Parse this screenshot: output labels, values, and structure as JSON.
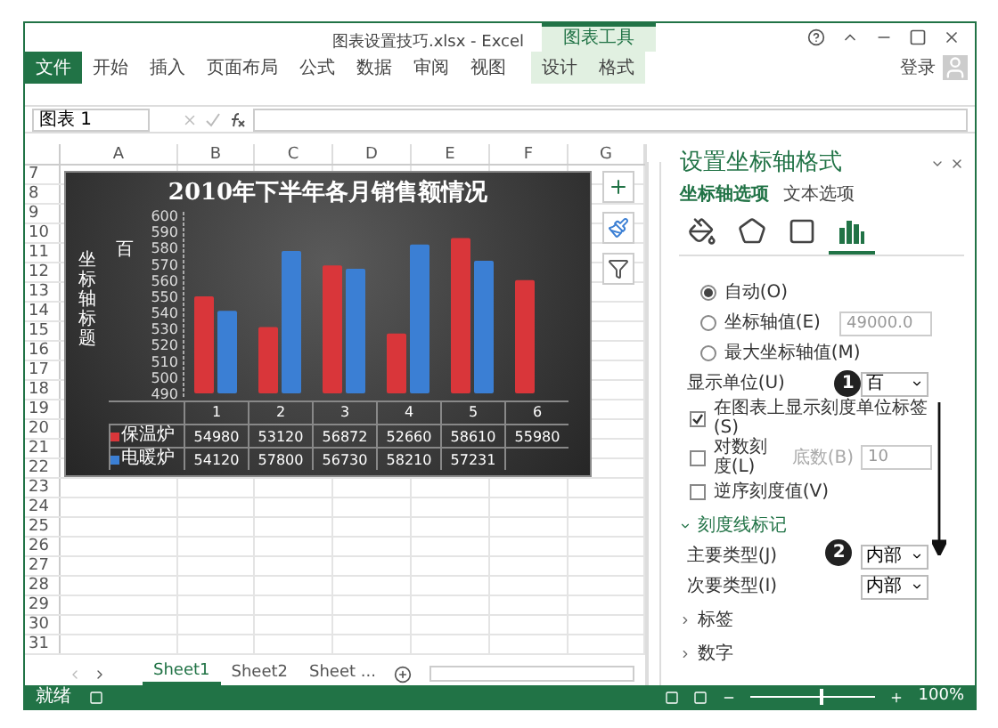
{
  "window": {
    "title": "图表设置技巧.xlsx - Excel"
  },
  "ribbon": {
    "context_group": "图表工具",
    "account": "登录",
    "tabs": [
      {
        "label": "文件",
        "kind": "file"
      },
      {
        "label": "开始",
        "kind": "normal"
      },
      {
        "label": "插入",
        "kind": "normal"
      },
      {
        "label": "页面布局",
        "kind": "normal"
      },
      {
        "label": "公式",
        "kind": "normal"
      },
      {
        "label": "数据",
        "kind": "normal"
      },
      {
        "label": "审阅",
        "kind": "normal"
      },
      {
        "label": "视图",
        "kind": "normal"
      },
      {
        "label": "设计",
        "kind": "contextual"
      },
      {
        "label": "格式",
        "kind": "contextual"
      }
    ]
  },
  "formula_bar": {
    "name_box": "图表 1"
  },
  "sheet": {
    "columns": [
      "A",
      "B",
      "C",
      "D",
      "E",
      "F",
      "G"
    ],
    "rows": [
      "7",
      "8",
      "9",
      "10",
      "11",
      "12",
      "13",
      "14",
      "15",
      "16",
      "17",
      "18",
      "19",
      "20",
      "21",
      "22",
      "23",
      "24",
      "25",
      "26",
      "27",
      "28",
      "29",
      "30",
      "31"
    ]
  },
  "chart": {
    "display_unit_label": "百",
    "chart_data": {
      "type": "bar",
      "title": "2010年下半年各月销售额情况",
      "ylabel": "坐标轴标题",
      "categories": [
        "1",
        "2",
        "3",
        "4",
        "5",
        "6"
      ],
      "series": [
        {
          "name": "保温炉",
          "color": "#d9363a",
          "values": [
            550,
            531,
            569,
            527,
            586,
            560
          ]
        },
        {
          "name": "电暖炉",
          "color": "#3b7fd4",
          "values": [
            541,
            578,
            567,
            582,
            572,
            null
          ]
        }
      ],
      "legend": "bottom-left",
      "ylim": [
        490,
        600
      ],
      "yticks": [
        490,
        500,
        510,
        520,
        530,
        540,
        550,
        560,
        570,
        580,
        590,
        600
      ]
    },
    "data_table": [
      {
        "cells": [
          "54980",
          "53120",
          "56872",
          "52660",
          "58610",
          "55980"
        ]
      },
      {
        "cells": [
          "54120",
          "57800",
          "56730",
          "58210",
          "57231",
          ""
        ]
      }
    ]
  },
  "format_pane": {
    "title": "设置坐标轴格式",
    "tabs": [
      {
        "label": "坐标轴选项",
        "selected": true
      },
      {
        "label": "文本选项",
        "selected": false
      }
    ],
    "icon_tabs": [
      {
        "kind": "fill",
        "selected": false
      },
      {
        "kind": "effects",
        "selected": false
      },
      {
        "kind": "size",
        "selected": false
      },
      {
        "kind": "axis",
        "selected": true
      }
    ],
    "options": [
      {
        "kind": "radio",
        "label": "自动(O)",
        "selected": true
      },
      {
        "kind": "radio",
        "label": "坐标轴值(E)",
        "selected": false,
        "value": "49000.0",
        "disabled": true
      },
      {
        "kind": "radio",
        "label": "最大坐标轴值(M)",
        "selected": false
      },
      {
        "kind": "select",
        "label": "显示单位(U)",
        "value": "百"
      },
      {
        "kind": "checkbox",
        "label": "在图表上显示刻度单位标签(S)",
        "checked": true
      },
      {
        "kind": "checkbox",
        "label": "对数刻度(L)",
        "checked": false,
        "field_label": "底数(B)",
        "value": "10",
        "disabled": true
      },
      {
        "kind": "checkbox",
        "label": "逆序刻度值(V)",
        "checked": false
      },
      {
        "kind": "section",
        "label": "刻度线标记",
        "expanded": true
      },
      {
        "kind": "select",
        "label": "主要类型(J)",
        "value": "内部"
      },
      {
        "kind": "select",
        "label": "次要类型(I)",
        "value": "内部"
      },
      {
        "kind": "section",
        "label": "标签",
        "expanded": false
      },
      {
        "kind": "section",
        "label": "数字",
        "expanded": false
      }
    ]
  },
  "callouts": [
    "1",
    "2"
  ],
  "sheet_tabs": [
    {
      "label": "Sheet1",
      "selected": true
    },
    {
      "label": "Sheet2",
      "selected": false
    },
    {
      "label": "Sheet ...",
      "selected": false
    }
  ],
  "status_bar": {
    "status": "就绪",
    "zoom": {
      "level": 0.55,
      "reading": "100%"
    }
  }
}
